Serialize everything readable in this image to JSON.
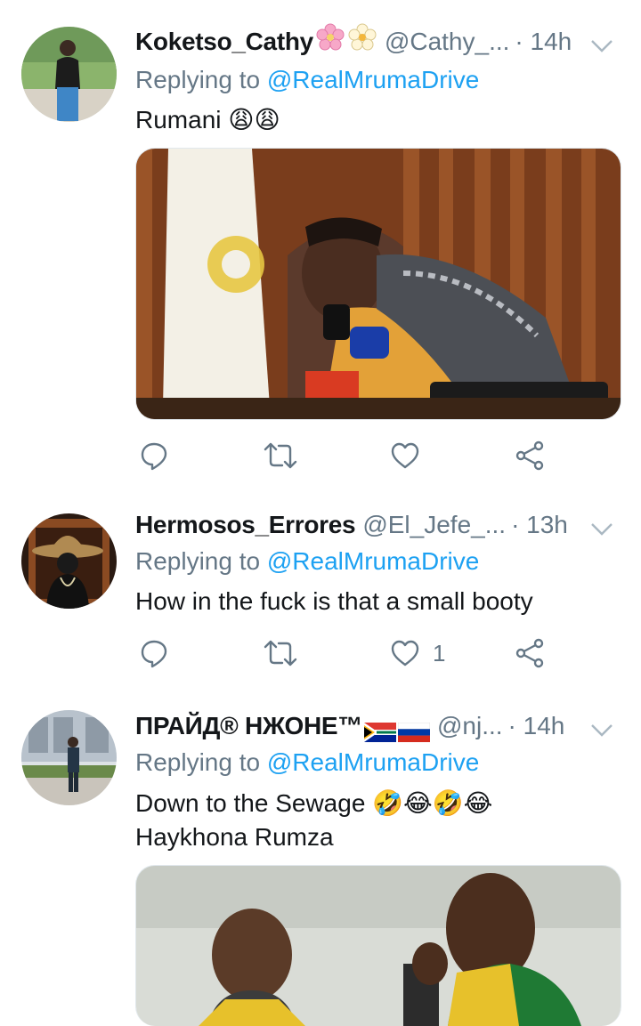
{
  "reply_prefix": "Replying to",
  "tweets": [
    {
      "name": "Koketso_Cathy",
      "handle": "@Cathy_...",
      "time": "· 14h",
      "mention": "@RealMrumaDrive",
      "text_lines": [
        "Rumani 😩😩"
      ],
      "like_count": ""
    },
    {
      "name": "Hermosos_Errores",
      "handle": "@El_Jefe_...",
      "time": "· 13h",
      "mention": "@RealMrumaDrive",
      "text_lines": [
        "How in the fuck is that a small booty"
      ],
      "like_count": "1"
    },
    {
      "name": "ПРАЙД® НЖОНЕ™",
      "handle": "@nj...",
      "time": "· 14h",
      "mention": "@RealMrumaDrive",
      "text_lines": [
        "Down to the Sewage 🤣😂🤣😂",
        "Haykhona Rumza"
      ],
      "like_count": ""
    }
  ],
  "icons": {
    "reply": "reply-icon",
    "retweet": "retweet-icon",
    "like": "heart-icon",
    "share": "share-icon",
    "more": "chevron-down-icon"
  },
  "colors": {
    "accent": "#1da1f2",
    "secondary_text": "#657786",
    "divider": "#e1e8ed"
  }
}
